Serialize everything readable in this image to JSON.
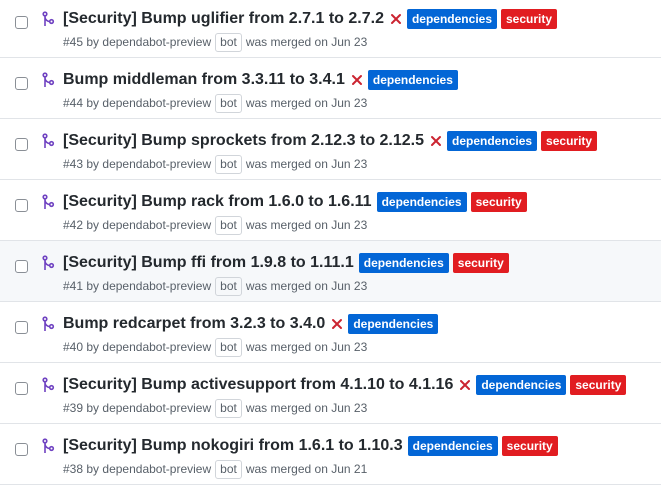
{
  "colors": {
    "dependencies_label": "#0366d6",
    "security_label": "#e11d21",
    "close_x": "#cb2431",
    "merged_icon": "#6f42c1"
  },
  "icons": {
    "pr_state": "git-merge-icon",
    "ci_status": "x-icon"
  },
  "pull_requests": [
    {
      "title": "[Security] Bump uglifier from 2.7.1 to 2.7.2",
      "number": "#45",
      "by": "by",
      "author": "dependabot-preview",
      "author_badge": "bot",
      "status_text": "was merged on Jun 23",
      "ci_failed": true,
      "labels": [
        "dependencies",
        "security"
      ]
    },
    {
      "title": "Bump middleman from 3.3.11 to 3.4.1",
      "number": "#44",
      "by": "by",
      "author": "dependabot-preview",
      "author_badge": "bot",
      "status_text": "was merged on Jun 23",
      "ci_failed": true,
      "labels": [
        "dependencies"
      ]
    },
    {
      "title": "[Security] Bump sprockets from 2.12.3 to 2.12.5",
      "number": "#43",
      "by": "by",
      "author": "dependabot-preview",
      "author_badge": "bot",
      "status_text": "was merged on Jun 23",
      "ci_failed": true,
      "labels": [
        "dependencies",
        "security"
      ]
    },
    {
      "title": "[Security] Bump rack from 1.6.0 to 1.6.11",
      "number": "#42",
      "by": "by",
      "author": "dependabot-preview",
      "author_badge": "bot",
      "status_text": "was merged on Jun 23",
      "ci_failed": false,
      "labels": [
        "dependencies",
        "security"
      ]
    },
    {
      "title": "[Security] Bump ffi from 1.9.8 to 1.11.1",
      "number": "#41",
      "by": "by",
      "author": "dependabot-preview",
      "author_badge": "bot",
      "status_text": "was merged on Jun 23",
      "ci_failed": false,
      "labels": [
        "dependencies",
        "security"
      ]
    },
    {
      "title": "Bump redcarpet from 3.2.3 to 3.4.0",
      "number": "#40",
      "by": "by",
      "author": "dependabot-preview",
      "author_badge": "bot",
      "status_text": "was merged on Jun 23",
      "ci_failed": true,
      "labels": [
        "dependencies"
      ]
    },
    {
      "title": "[Security] Bump activesupport from 4.1.10 to 4.1.16",
      "number": "#39",
      "by": "by",
      "author": "dependabot-preview",
      "author_badge": "bot",
      "status_text": "was merged on Jun 23",
      "ci_failed": true,
      "labels": [
        "dependencies",
        "security"
      ]
    },
    {
      "title": "[Security] Bump nokogiri from 1.6.1 to 1.10.3",
      "number": "#38",
      "by": "by",
      "author": "dependabot-preview",
      "author_badge": "bot",
      "status_text": "was merged on Jun 21",
      "ci_failed": false,
      "labels": [
        "dependencies",
        "security"
      ]
    }
  ]
}
